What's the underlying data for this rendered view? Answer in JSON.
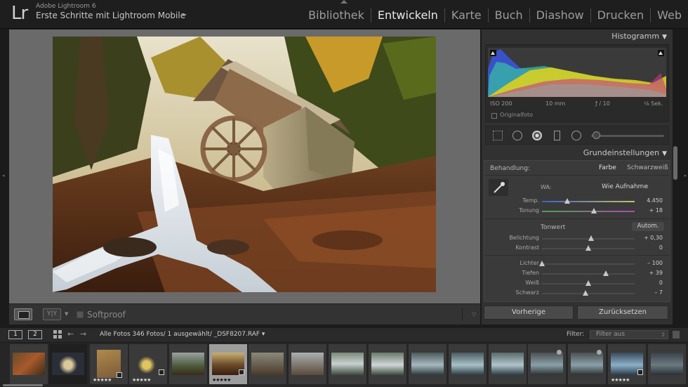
{
  "app": {
    "logo": "Lr",
    "name": "Adobe Lightroom 6",
    "catalog": "Erste Schritte mit Lightroom Mobile",
    "catalog_arrow": "►"
  },
  "modules": [
    {
      "label": "Bibliothek",
      "active": false
    },
    {
      "label": "Entwickeln",
      "active": true
    },
    {
      "label": "Karte",
      "active": false
    },
    {
      "label": "Buch",
      "active": false
    },
    {
      "label": "Diashow",
      "active": false
    },
    {
      "label": "Drucken",
      "active": false
    },
    {
      "label": "Web",
      "active": false
    }
  ],
  "toolbar": {
    "yy_label": "Y|Y",
    "softproof": "Softproof"
  },
  "histogram": {
    "title": "Histogramm",
    "iso": "ISO 200",
    "focal": "10 mm",
    "aperture": "ƒ / 10",
    "shutter": "¹⁄₈ Sek.",
    "original_label": "Originalfoto"
  },
  "basic": {
    "title": "Grundeinstellungen",
    "treatment_label": "Behandlung:",
    "treatment_color": "Farbe",
    "treatment_bw": "Schwarzweiß",
    "wb_label": "WA:",
    "wb_value": "Wie Aufnahme",
    "wb_caret": "⇕",
    "tone_label": "Tonwert",
    "auto_label": "Autom.",
    "sliders": {
      "temp": {
        "label": "Temp.",
        "value": "4.450",
        "level": 0.27
      },
      "tint": {
        "label": "Tonung",
        "value": "+ 18",
        "level": 0.56
      },
      "exposure": {
        "label": "Belichtung",
        "value": "+ 0,30",
        "level": 0.53
      },
      "contrast": {
        "label": "Kontrast",
        "value": "0",
        "level": 0.5
      },
      "highlights": {
        "label": "Lichter",
        "value": "– 100",
        "level": 0.0
      },
      "shadows": {
        "label": "Tiefen",
        "value": "+ 39",
        "level": 0.69
      },
      "whites": {
        "label": "Weiß",
        "value": "0",
        "level": 0.5
      },
      "blacks": {
        "label": "Schwarz",
        "value": "– 7",
        "level": 0.47
      }
    }
  },
  "buttons": {
    "previous": "Vorherige",
    "reset": "Zurücksetzen"
  },
  "filmstrip_bar": {
    "view1": "1",
    "view2": "2",
    "source": "Alle Fotos    346 Fotos/ 1 ausgewählt/ _DSF8207.RAF ▾",
    "filter_label": "Filter:",
    "filter_value": "Filter aus"
  },
  "filmstrip": {
    "stars": "★★★★★"
  },
  "colors": {
    "accent_text": "#e8e8e8",
    "panel_bg": "#313131",
    "workspace_bg": "#6a6a6a",
    "selected_cell": "#9d9d9d"
  }
}
